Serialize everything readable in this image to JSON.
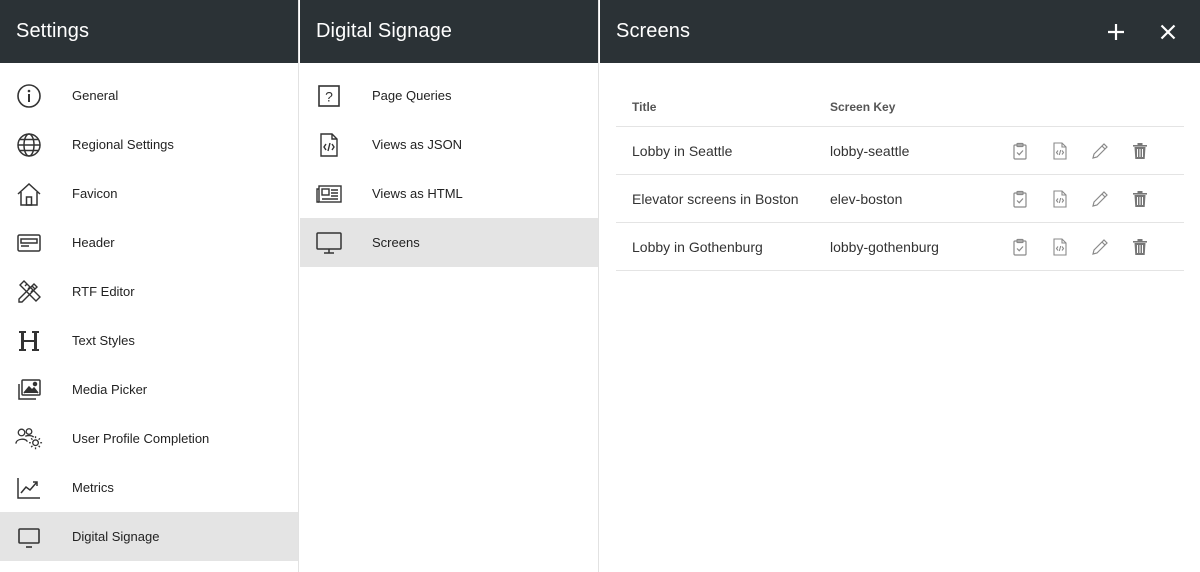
{
  "settings_panel": {
    "title": "Settings",
    "items": [
      {
        "label": "General",
        "icon": "info-icon"
      },
      {
        "label": "Regional Settings",
        "icon": "globe-icon"
      },
      {
        "label": "Favicon",
        "icon": "home-icon"
      },
      {
        "label": "Header",
        "icon": "header-icon"
      },
      {
        "label": "RTF Editor",
        "icon": "pencil-ruler-icon"
      },
      {
        "label": "Text Styles",
        "icon": "heading-icon"
      },
      {
        "label": "Media Picker",
        "icon": "images-icon"
      },
      {
        "label": "User Profile Completion",
        "icon": "users-gear-icon"
      },
      {
        "label": "Metrics",
        "icon": "chart-line-icon"
      },
      {
        "label": "Digital Signage",
        "icon": "monitor-icon",
        "active": true
      }
    ]
  },
  "signage_panel": {
    "title": "Digital Signage",
    "items": [
      {
        "label": "Page Queries",
        "icon": "question-box-icon"
      },
      {
        "label": "Views as JSON",
        "icon": "code-file-icon"
      },
      {
        "label": "Views as HTML",
        "icon": "newspaper-icon"
      },
      {
        "label": "Screens",
        "icon": "monitor-icon",
        "active": true
      }
    ]
  },
  "screens_panel": {
    "title": "Screens",
    "add_icon": "plus-icon",
    "close_icon": "close-icon",
    "columns": {
      "title": "Title",
      "key": "Screen Key"
    },
    "rows": [
      {
        "title": "Lobby in Seattle",
        "key": "lobby-seattle"
      },
      {
        "title": "Elevator screens in Boston",
        "key": "elev-boston"
      },
      {
        "title": "Lobby in Gothenburg",
        "key": "lobby-gothenburg"
      }
    ],
    "row_action_icons": [
      "clipboard-check-icon",
      "code-file-icon",
      "pencil-icon",
      "trash-icon"
    ]
  },
  "colors": {
    "header_bg": "#2b3236",
    "active_bg": "#e4e4e4",
    "icon": "#333333",
    "row_icon": "#8a8a8a"
  }
}
